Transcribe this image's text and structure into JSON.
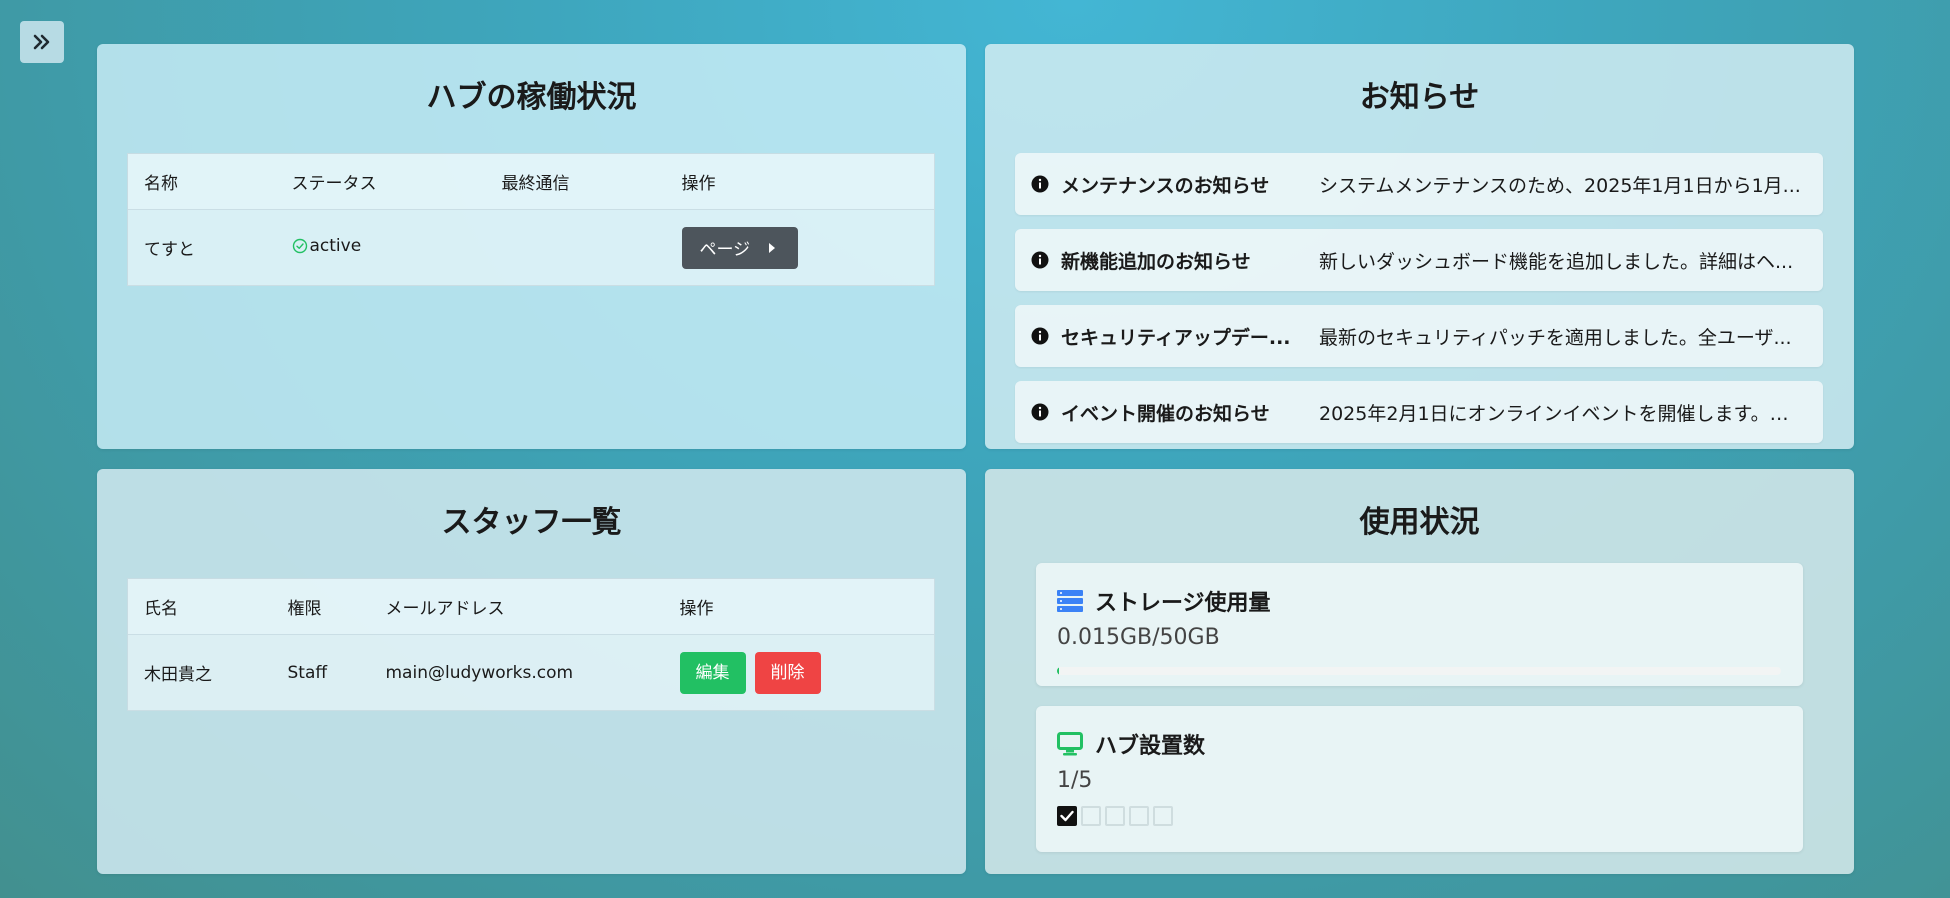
{
  "hub_status": {
    "title": "ハブの稼働状況",
    "columns": [
      "名称",
      "ステータス",
      "最終通信",
      "操作"
    ],
    "rows": [
      {
        "name": "てすと",
        "status": "active",
        "last_comm": "",
        "action_label": "ページ"
      }
    ]
  },
  "news": {
    "title": "お知らせ",
    "items": [
      {
        "title": "メンテナンスのお知らせ",
        "body": "システムメンテナンスのため、2025年1月1日から1月..."
      },
      {
        "title": "新機能追加のお知らせ",
        "body": "新しいダッシュボード機能を追加しました。詳細はヘ..."
      },
      {
        "title": "セキュリティアップデー...",
        "body": "最新のセキュリティパッチを適用しました。全ユーザ..."
      },
      {
        "title": "イベント開催のお知らせ",
        "body": "2025年2月1日にオンラインイベントを開催します。参..."
      }
    ]
  },
  "staff": {
    "title": "スタッフ一覧",
    "columns": [
      "氏名",
      "権限",
      "メールアドレス",
      "操作"
    ],
    "rows": [
      {
        "name": "木田貴之",
        "role": "Staff",
        "email": "main@ludyworks.com",
        "edit_label": "編集",
        "delete_label": "削除"
      }
    ]
  },
  "usage": {
    "title": "使用状況",
    "storage": {
      "label": "ストレージ使用量",
      "value_text": "0.015GB/50GB",
      "used_fraction": 0.0003
    },
    "hubs": {
      "label": "ハブ設置数",
      "value_text": "1/5",
      "used": 1,
      "total": 5
    }
  },
  "icons": {
    "sidebar_toggle": "double-chevron-right-icon",
    "status_ok": "check-circle-icon",
    "page_arrow": "caret-right-icon",
    "info": "info-circle-icon",
    "storage": "database-icon",
    "hub": "monitor-icon"
  },
  "colors": {
    "success": "#22c063",
    "danger": "#ef4444",
    "dark_button": "#4d555c",
    "storage_icon": "#3b82f6"
  }
}
